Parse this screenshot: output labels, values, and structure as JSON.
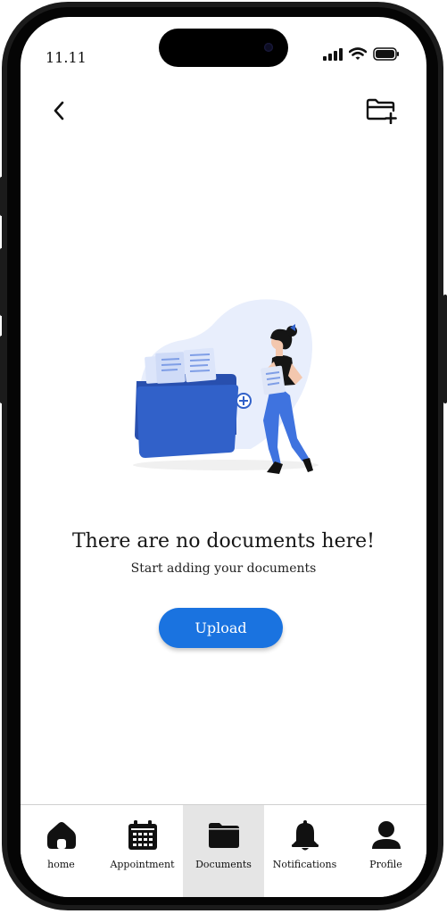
{
  "status_bar": {
    "time": "11.11",
    "icons": [
      "signal-icon",
      "wifi-icon",
      "battery-icon"
    ]
  },
  "header": {
    "back_icon": "chevron-left-icon",
    "action_icon": "new-folder-icon"
  },
  "empty_state": {
    "illustration": "woman-with-document-folder",
    "title": "There are no documents here!",
    "subtitle": "Start adding your documents",
    "upload_label": "Upload"
  },
  "bottom_nav": {
    "active": "Documents",
    "items": [
      {
        "label": "home",
        "icon": "home-icon"
      },
      {
        "label": "Appointment",
        "icon": "calendar-icon"
      },
      {
        "label": "Documents",
        "icon": "folder-icon"
      },
      {
        "label": "Notifications",
        "icon": "bell-icon"
      },
      {
        "label": "Profile",
        "icon": "profile-icon"
      }
    ]
  },
  "colors": {
    "primary": "#1a73e0",
    "folder": "#2f5fc6",
    "active_tab_bg": "#e5e5e5",
    "blob": "#e8eefc"
  }
}
